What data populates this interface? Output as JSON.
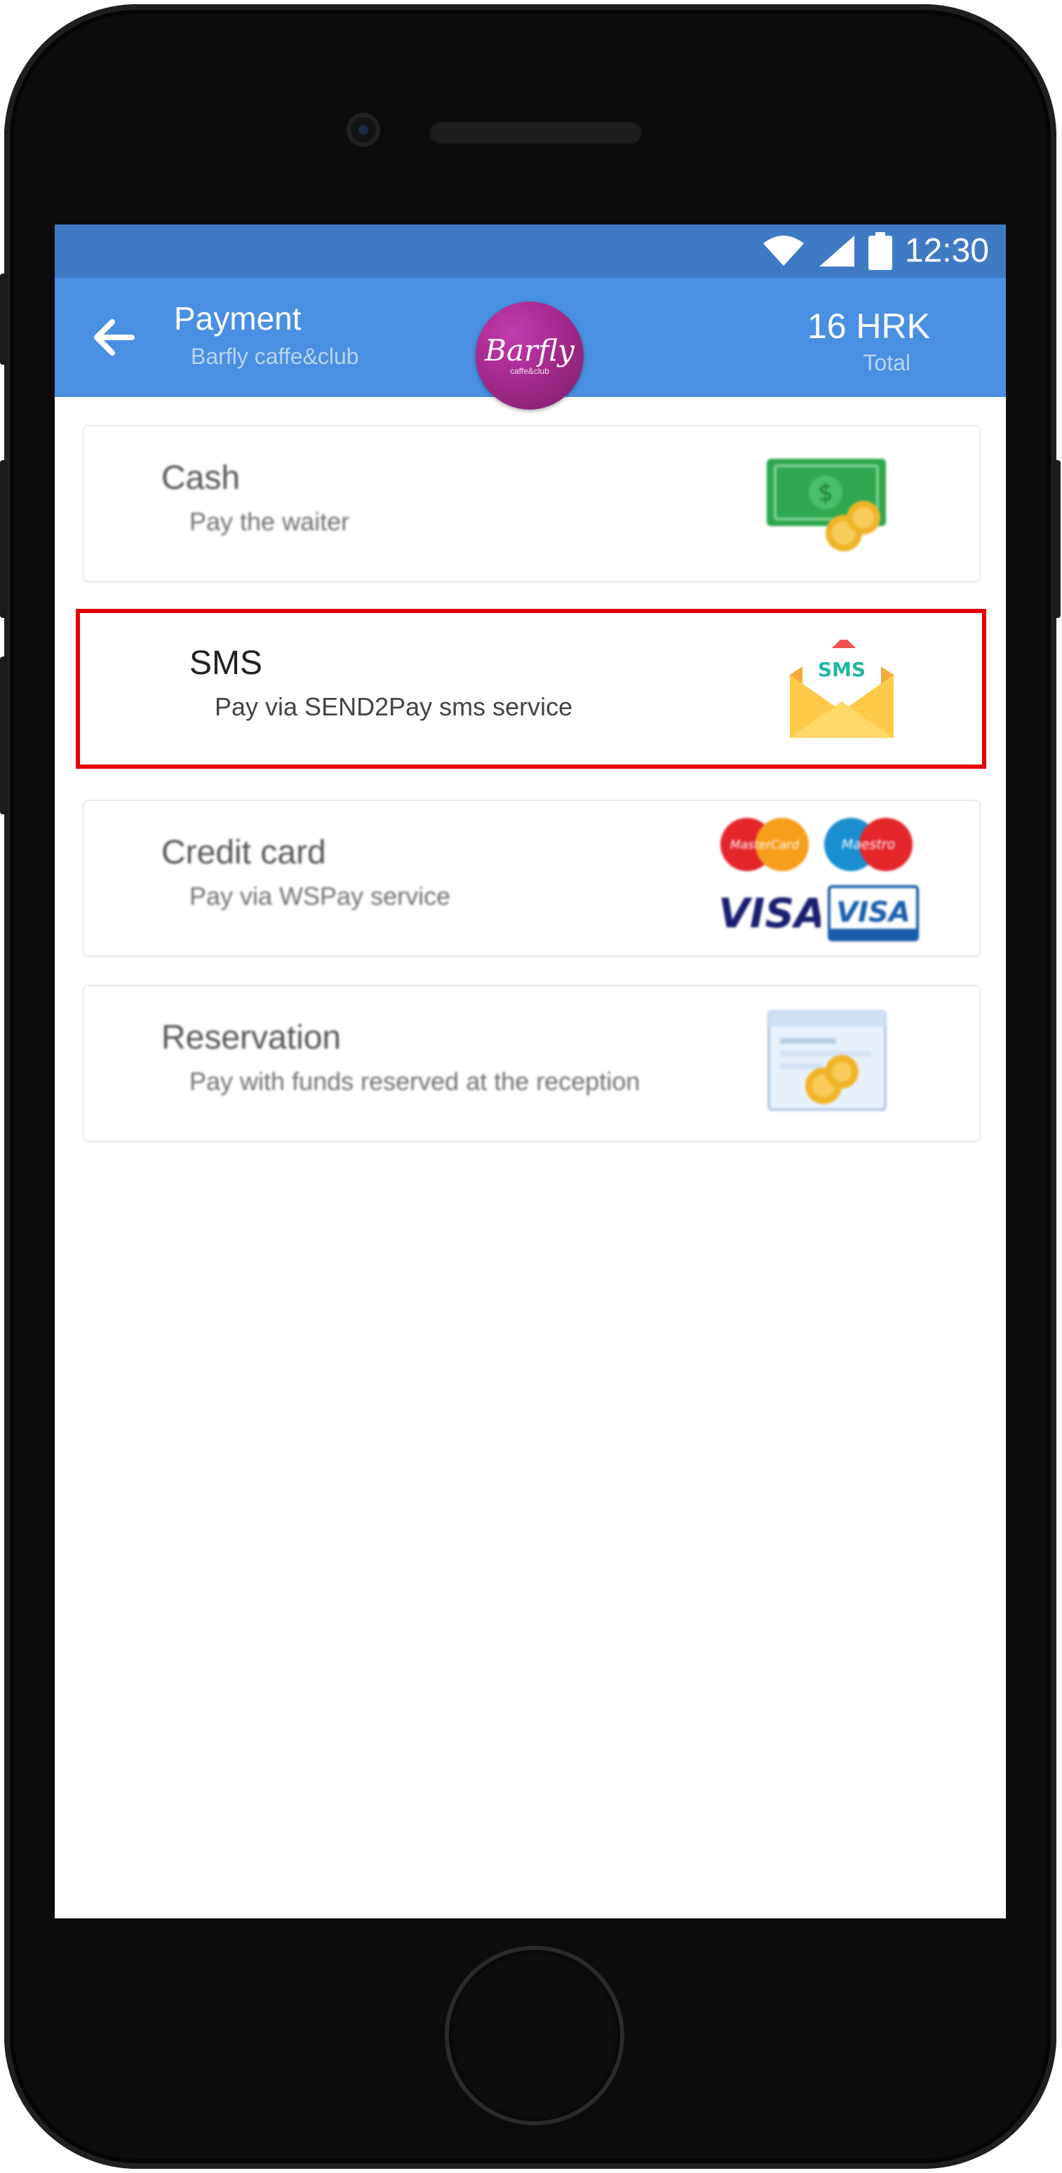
{
  "status_bar": {
    "time": "12:30"
  },
  "header": {
    "title": "Payment",
    "subtitle": "Barfly caffe&club",
    "logo_text": "Barfly",
    "logo_subtext": "caffe&club",
    "total_amount": "16 HRK",
    "total_label": "Total"
  },
  "payment_methods": [
    {
      "name": "Cash",
      "description": "Pay the waiter",
      "icon": "cash-coins-icon"
    },
    {
      "name": "SMS",
      "description": "Pay via SEND2Pay sms service",
      "icon": "sms-envelope-icon",
      "badge": "SMS",
      "highlighted": true
    },
    {
      "name": "Credit card",
      "description": "Pay via  WSPay service",
      "icon": "card-logos-icon",
      "card_logos": [
        "MasterCard",
        "Maestro",
        "VISA",
        "VISA"
      ]
    },
    {
      "name": "Reservation",
      "description": "Pay with funds reserved at the reception",
      "icon": "reservation-coins-icon"
    }
  ],
  "colors": {
    "status_bar": "#3f7ac5",
    "app_bar": "#4a90e2",
    "highlight": "#e40000",
    "logo": "#a52a8e"
  }
}
